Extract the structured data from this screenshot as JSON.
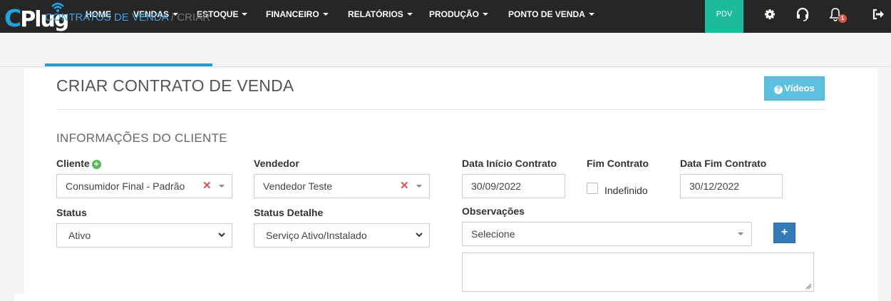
{
  "nav": {
    "logo_text": "CPlug",
    "items": [
      {
        "label": "HOME",
        "dropdown": false
      },
      {
        "label": "VENDAS",
        "dropdown": true
      },
      {
        "label": "ESTOQUE",
        "dropdown": true
      },
      {
        "label": "FINANCEIRO",
        "dropdown": true
      },
      {
        "label": "RELATÓRIOS",
        "dropdown": true
      },
      {
        "label": "PRODUÇÃO",
        "dropdown": true
      },
      {
        "label": "PONTO DE VENDA",
        "dropdown": true
      }
    ],
    "pdv_label": "PDV",
    "notification_count": "1",
    "icons": [
      "gear-icon",
      "headset-icon",
      "bell-icon",
      "logout-icon"
    ]
  },
  "breadcrumb": {
    "parent": "CONTRATOS DE VENDA",
    "separator": " / ",
    "current": "CRIAR"
  },
  "page": {
    "title": "CRIAR CONTRATO DE VENDA",
    "videos_label": "Vídeos"
  },
  "section": {
    "title": "INFORMAÇÕES DO CLIENTE"
  },
  "form": {
    "cliente_label": "Cliente",
    "cliente_value": "Consumidor Final - Padrão",
    "vendedor_label": "Vendedor",
    "vendedor_value": "Vendedor Teste",
    "data_inicio_label": "Data Início Contrato",
    "data_inicio_value": "30/09/2022",
    "fim_contrato_label": "Fim Contrato",
    "indefinido_label": "Indefinido",
    "indefinido_checked": false,
    "data_fim_label": "Data Fim Contrato",
    "data_fim_value": "30/12/2022",
    "status_label": "Status",
    "status_value": "Ativo",
    "status_detalhe_label": "Status Detalhe",
    "status_detalhe_value": "Serviço Ativo/Instalado",
    "observacoes_label": "Observações",
    "observacoes_placeholder": "Selecione",
    "observacoes_text": ""
  },
  "colors": {
    "navbar": "#262626",
    "pdv": "#1abc9c",
    "accent": "#1e9ce0",
    "videos": "#5bc0de",
    "plus": "#337ab7",
    "clear": "#d9534f"
  }
}
